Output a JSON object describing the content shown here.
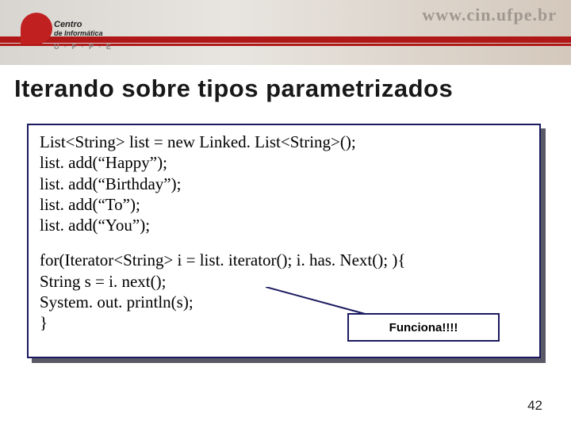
{
  "header": {
    "url": "www.cin.ufpe.br",
    "logo_line1": "Centro",
    "logo_line2": "de Informática",
    "logo_sub": "U · F · P · E"
  },
  "title": "Iterando sobre tipos parametrizados",
  "code": {
    "l1": "List<String> list = new Linked. List<String>();",
    "l2": "list. add(“Happy”);",
    "l3": "list. add(“Birthday”);",
    "l4": "list. add(“To”);",
    "l5": "list. add(“You”);",
    "l6": "for(Iterator<String> i = list. iterator(); i. has. Next(); ){",
    "l7": "String s = i. next();",
    "l8": "System. out. println(s);",
    "l9": "}"
  },
  "callout": "Funciona!!!!",
  "page": "42"
}
